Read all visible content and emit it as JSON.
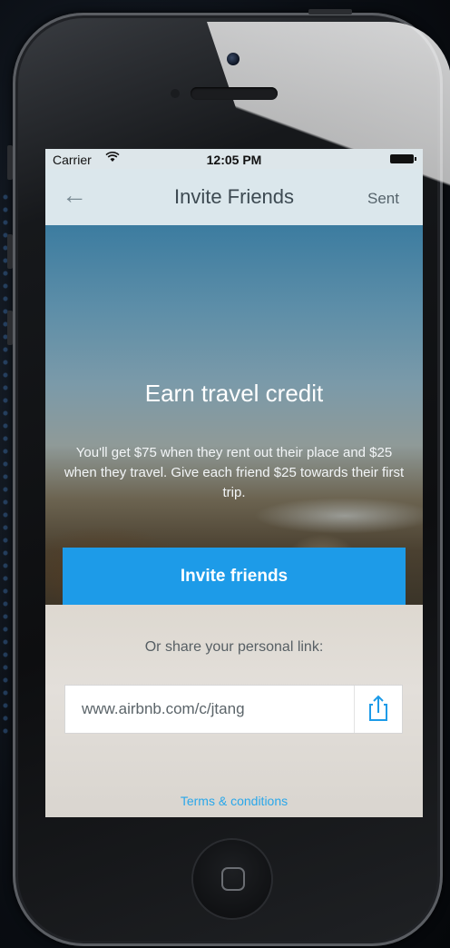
{
  "status": {
    "carrier": "Carrier",
    "time": "12:05 PM"
  },
  "nav": {
    "back": "←",
    "title": "Invite Friends",
    "sent": "Sent"
  },
  "hero": {
    "title": "Earn travel credit",
    "text": "You'll get $75 when they rent out their place and $25 when they travel. Give each friend $25 towards their first trip.",
    "button": "Invite friends"
  },
  "share": {
    "label": "Or share your personal link:",
    "link": "www.airbnb.com/c/jtang",
    "share_icon": "share-icon"
  },
  "terms": "Terms & conditions",
  "colors": {
    "accent": "#1d9be8",
    "link": "#2aa7ea",
    "nav_bg": "#dbe7ec"
  }
}
